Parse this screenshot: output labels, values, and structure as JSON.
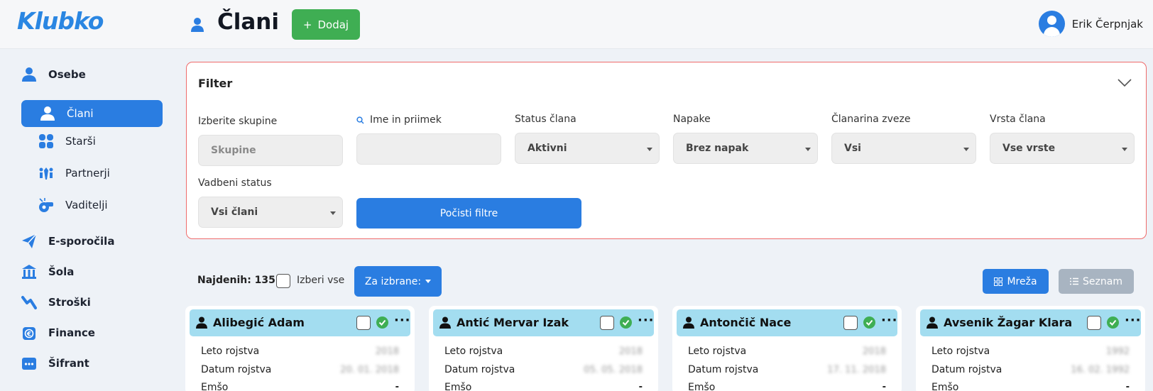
{
  "app": {
    "logo": "Klubko"
  },
  "header": {
    "title": "Člani",
    "add_label": "Dodaj",
    "user_name": "Erik Čerpnjak"
  },
  "sidebar": {
    "items": [
      {
        "label": "Osebe",
        "icon": "person-icon"
      },
      {
        "label": "Člani",
        "icon": "person-icon",
        "active": true
      },
      {
        "label": "Starši",
        "icon": "parents-icon"
      },
      {
        "label": "Partnerji",
        "icon": "partners-icon"
      },
      {
        "label": "Vaditelji",
        "icon": "whistle-icon"
      },
      {
        "label": "E-sporočila",
        "icon": "paper-plane-icon"
      },
      {
        "label": "Šola",
        "icon": "school-icon"
      },
      {
        "label": "Stroški",
        "icon": "chart-line-icon"
      },
      {
        "label": "Finance",
        "icon": "euro-icon"
      },
      {
        "label": "Šifrant",
        "icon": "dots-icon"
      }
    ]
  },
  "filter": {
    "title": "Filter",
    "groups_label": "Izberite skupine",
    "groups_placeholder": "Skupine",
    "name_label": "Ime in priimek",
    "name_value": "",
    "status_label": "Status člana",
    "status_value": "Aktivni",
    "errors_label": "Napake",
    "errors_value": "Brez napak",
    "fee_label": "Članarina zveze",
    "fee_value": "Vsi",
    "type_label": "Vrsta člana",
    "type_value": "Vse vrste",
    "training_label": "Vadbeni status",
    "training_value": "Vsi člani",
    "clear_label": "Počisti filtre"
  },
  "results": {
    "found": "Najdenih: 135",
    "select_all": "Izberi vse",
    "bulk_label": "Za izbrane:",
    "grid_label": "Mreža",
    "list_label": "Seznam"
  },
  "cards": [
    {
      "name": "Alibegić Adam",
      "year": "2018",
      "birth": "20. 01. 2018",
      "emso": "-"
    },
    {
      "name": "Antić Mervar Izak",
      "year": "2018",
      "birth": "05. 05. 2018",
      "emso": "-"
    },
    {
      "name": "Antončič Nace",
      "year": "2018",
      "birth": "17. 11. 2018",
      "emso": "-"
    },
    {
      "name": "Avsenik Žagar Klara",
      "year": "1992",
      "birth": "16. 02. 1992",
      "emso": "-"
    }
  ],
  "card_labels": {
    "year": "Leto rojstva",
    "birth": "Datum rojstva",
    "emso": "Emšo"
  },
  "colors": {
    "primary": "#2a7de1",
    "success": "#3fae53",
    "card_header": "#a3ddf0",
    "filter_border": "#ef6b6b"
  }
}
